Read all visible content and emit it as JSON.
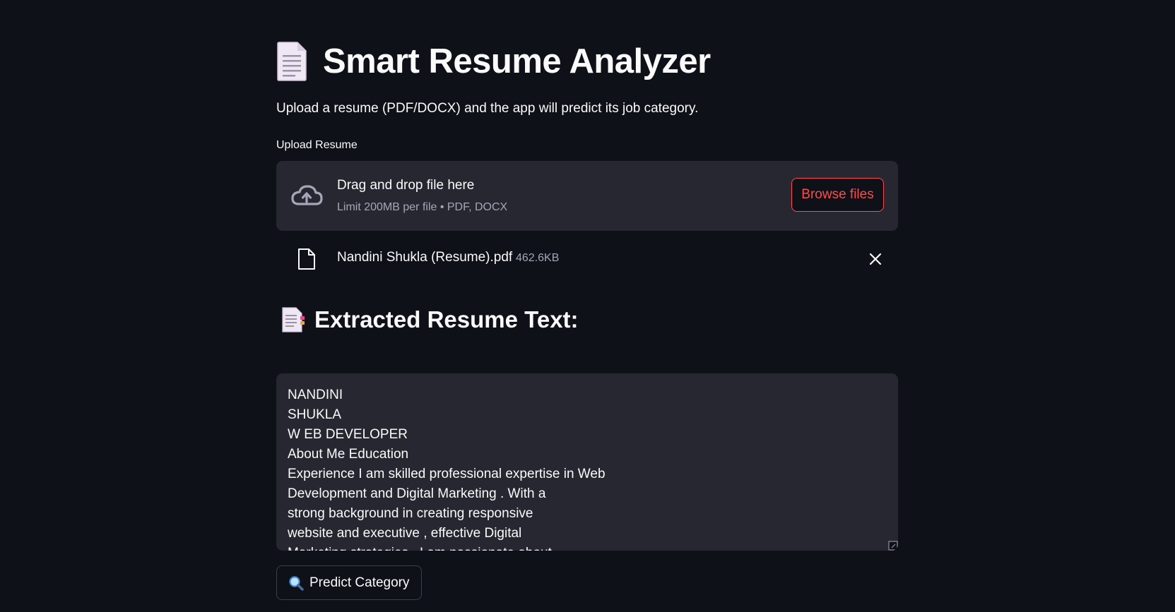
{
  "header": {
    "title": "Smart Resume Analyzer",
    "title_icon": "page-facing-up-icon",
    "subtitle": "Upload a resume (PDF/DOCX) and the app will predict its job category."
  },
  "uploader": {
    "label": "Upload Resume",
    "drop_title": "Drag and drop file here",
    "drop_limit": "Limit 200MB per file • PDF, DOCX",
    "browse_label": "Browse files",
    "icon": "cloud-upload-icon",
    "accent_color": "#ff4b4b"
  },
  "uploaded_file": {
    "name": "Nandini Shukla (Resume).pdf",
    "size": "462.6KB",
    "icon": "file-icon",
    "remove_icon": "close-icon"
  },
  "extracted": {
    "heading": "Extracted Resume Text:",
    "heading_icon": "bookmark-tabs-icon",
    "text": "NANDINI\nSHUKLA\nW EB DEVELOPER\nAbout Me Education\nExperience I am skilled professional expertise in Web\nDevelopment and Digital Marketing . With a\nstrong background in creating responsive\nwebsite and executive , effective Digital\nMarketing strategies . I am passionate about"
  },
  "predict": {
    "label": "Predict Category",
    "icon": "magnifying-glass-icon"
  }
}
